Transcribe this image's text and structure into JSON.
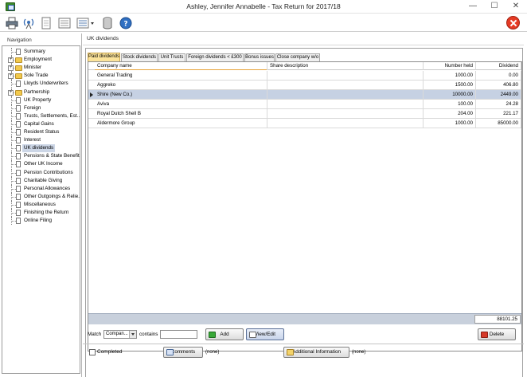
{
  "window": {
    "title": "Ashley, Jennifer Annabelle - Tax Return for 2017/18",
    "minimize": "—",
    "maximize": "☐",
    "close": "✕"
  },
  "toolbar": {
    "icons": [
      "printer-icon",
      "broadcast-icon",
      "document-icon",
      "form-icon",
      "list-dropdown-icon",
      "database-icon",
      "help-icon",
      "exit-icon"
    ]
  },
  "navigation": {
    "title": "Navigation",
    "items": [
      {
        "label": "Summary",
        "kind": "doc"
      },
      {
        "label": "Employment",
        "kind": "folder"
      },
      {
        "label": "Minister",
        "kind": "folder"
      },
      {
        "label": "Sole Trade",
        "kind": "folder"
      },
      {
        "label": "Lloyds Underwriters",
        "kind": "doc"
      },
      {
        "label": "Partnership",
        "kind": "folder"
      },
      {
        "label": "UK Property",
        "kind": "doc"
      },
      {
        "label": "Foreign",
        "kind": "doc"
      },
      {
        "label": "Trusts, Settlements, Est...",
        "kind": "doc"
      },
      {
        "label": "Capital Gains",
        "kind": "doc"
      },
      {
        "label": "Resident Status",
        "kind": "doc"
      },
      {
        "label": "Interest",
        "kind": "doc"
      },
      {
        "label": "UK dividends",
        "kind": "doc",
        "selected": true
      },
      {
        "label": "Pensions & State Benefits",
        "kind": "doc"
      },
      {
        "label": "Other UK Income",
        "kind": "doc"
      },
      {
        "label": "Pension Contributions",
        "kind": "doc"
      },
      {
        "label": "Charitable Giving",
        "kind": "doc"
      },
      {
        "label": "Personal Allowances",
        "kind": "doc"
      },
      {
        "label": "Other Outgoings & Relie...",
        "kind": "doc"
      },
      {
        "label": "Miscellaneous",
        "kind": "doc"
      },
      {
        "label": "Finishing the Return",
        "kind": "doc"
      },
      {
        "label": "Online Filing",
        "kind": "doc"
      }
    ]
  },
  "main": {
    "title": "UK dividends",
    "tabs": [
      {
        "label": "Paid dividends",
        "active": true
      },
      {
        "label": "Stock dividends"
      },
      {
        "label": "Unit Trusts"
      },
      {
        "label": "Foreign dividends < £300"
      },
      {
        "label": "Bonus issues"
      },
      {
        "label": "Close company w/o"
      }
    ],
    "table": {
      "columns": [
        "Company name",
        "Share description",
        "Number held",
        "Dividend"
      ],
      "rows": [
        {
          "company": "General Trading",
          "description": "",
          "number": "1000.00",
          "dividend": "0.00"
        },
        {
          "company": "Aggreko",
          "description": "",
          "number": "1500.00",
          "dividend": "406.80"
        },
        {
          "company": "Shire (New Co.)",
          "description": "",
          "number": "10000.00",
          "dividend": "2449.00",
          "selected": true
        },
        {
          "company": "Aviva",
          "description": "",
          "number": "100.00",
          "dividend": "24.28"
        },
        {
          "company": "Royal Dutch Shell B",
          "description": "",
          "number": "204.00",
          "dividend": "221.17"
        },
        {
          "company": "Aldermore Group",
          "description": "",
          "number": "1000.00",
          "dividend": "85000.00"
        }
      ],
      "total": "88101.25"
    },
    "filter": {
      "match_label": "Match",
      "match_value": "Compan...",
      "contains_label": "contains",
      "contains_value": ""
    },
    "buttons": {
      "add": "Add",
      "view_edit": "View/Edit",
      "delete": "Delete"
    },
    "footer": {
      "completed_label": "Completed",
      "comments_label": "Comments",
      "comments_value": "(none)",
      "addinfo_label": "Additional Information",
      "addinfo_value": "(none)"
    }
  },
  "colors": {
    "active_tab": "#fbe39a",
    "selected_row": "#c6d1e3",
    "exit_button": "#e53a24",
    "header_underline": "#e6a33a"
  }
}
